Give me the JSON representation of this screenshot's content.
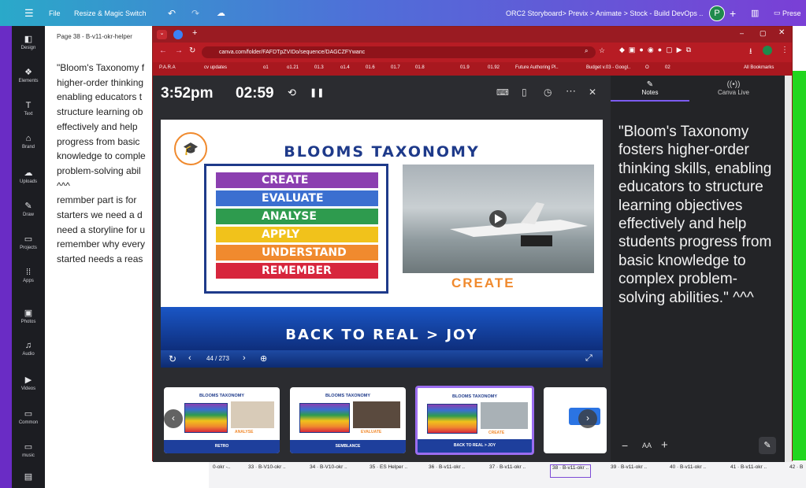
{
  "topbar": {
    "file": "File",
    "resize": "Resize & Magic Switch",
    "breadcrumb": "ORC2 Storyboard> Previx > Animate > Stock - Build DevOps ..",
    "avatar": "P",
    "present": "Prese"
  },
  "rail": [
    "Design",
    "Elements",
    "Text",
    "Brand",
    "Uploads",
    "Draw",
    "Projects",
    "Apps",
    "Photos",
    "Audio",
    "Videos",
    "Common",
    "music"
  ],
  "doc": {
    "page_header": "Page 38 - B-v11-okr-helper",
    "lines": [
      "\"Bloom's Taxonomy f",
      "higher-order thinking",
      "enabling educators t",
      "structure learning ob",
      "effectively and help",
      "progress from basic",
      "knowledge to comple",
      "problem-solving abil",
      "^^^",
      "remmber part is for",
      "starters we need a d",
      "need a storyline for u",
      "remember why every",
      "started needs a reas"
    ]
  },
  "browser": {
    "url": "canva.com/folder/FAFDTpZVIDo/sequence/DAGCZFYwanc",
    "bookmarks": [
      "P.A.R.A",
      "cv updates",
      "o1",
      "o1.21",
      "01.3",
      "o1.4",
      "01.6",
      "01.7",
      "01.8",
      "01.9",
      "01.92",
      "Future Authoring Pl..",
      "Budget v.03 - Googl..",
      "O",
      "02",
      "All Bookmarks"
    ]
  },
  "presenter": {
    "clock": "3:52pm",
    "timer": "02:59",
    "page_counter": "44 / 273",
    "tabs": {
      "notes": "Notes",
      "live": "Canva Live"
    }
  },
  "slide": {
    "title": "BLOOMS TAXONOMY",
    "levels": [
      "CREATE",
      "EVALUATE",
      "ANALYSE",
      "APPLY",
      "UNDERSTAND",
      "REMEMBER"
    ],
    "level_colors": [
      "#8b3fb0",
      "#3b6fd0",
      "#2e9b4e",
      "#f1c21b",
      "#f08a2e",
      "#d7263d"
    ],
    "caption": "CREATE",
    "banner": "BACK TO REAL > JOY"
  },
  "notes": {
    "text": "\"Bloom's Taxonomy fosters higher-order thinking skills, enabling educators to structure learning objectives effectively and help students progress from basic knowledge to complex problem-solving abilities.\" ^^^"
  },
  "thumbnails": [
    {
      "title": "BLOOMS TAXONOMY",
      "word": "ANALYSE",
      "band": "RETRO"
    },
    {
      "title": "BLOOMS TAXONOMY",
      "word": "EVALUATE",
      "band": "SEMBLANCE"
    },
    {
      "title": "BLOOMS TAXONOMY",
      "word": "CREATE",
      "band": "BACK TO REAL > JOY"
    }
  ],
  "strip": [
    "0-okr -..",
    "33 · B-V10-okr ..",
    "34 · B-V10-okr ..",
    "35 · ES Helper ..",
    "36 · B-v11-okr ..",
    "37 · B-v11-okr ..",
    "38 · B-v11-okr ..",
    "39 · B-v11-okr ..",
    "40 · B-v11-okr ..",
    "41 · B-v11-okr ..",
    "42 · B"
  ]
}
